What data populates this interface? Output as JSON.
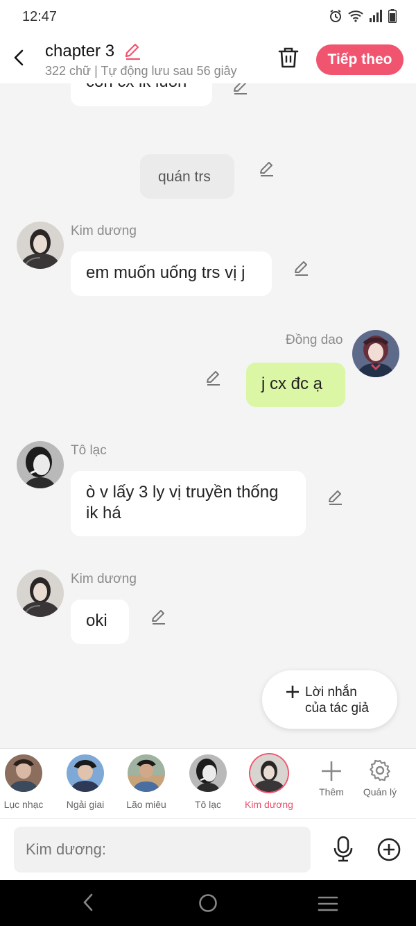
{
  "status": {
    "time": "12:47"
  },
  "header": {
    "title": "chapter 3",
    "subtitle": "322 chữ | Tự động lưu sau 56 giây",
    "next_label": "Tiếp theo"
  },
  "messages": [
    {
      "text": "con cx ik luôn"
    },
    {
      "text": "quán trs"
    },
    {
      "sender": "Kim dương",
      "text": "em muốn uống trs vị j"
    },
    {
      "sender": "Đồng dao",
      "text": "j cx đc ạ"
    },
    {
      "sender": "Tô lạc",
      "text_line1": "ò v lấy 3 ly vị truyền thống",
      "text_line2": "ik há"
    },
    {
      "sender": "Kim dương",
      "text": "oki"
    }
  ],
  "author_note": {
    "line1": "Lời nhắn",
    "line2": "của tác giả"
  },
  "characters": [
    {
      "name": "Lục nhạc"
    },
    {
      "name": "Ngải giai"
    },
    {
      "name": "Lão miêu"
    },
    {
      "name": "Tô lạc"
    },
    {
      "name": "Kim dương",
      "selected": true
    }
  ],
  "tools": {
    "add_label": "Thêm",
    "manage_label": "Quản lý"
  },
  "input": {
    "placeholder": "Kim dương:"
  },
  "colors": {
    "accent": "#f0546f",
    "bubble_green": "#dbf6a4",
    "bubble_white": "#ffffff"
  }
}
